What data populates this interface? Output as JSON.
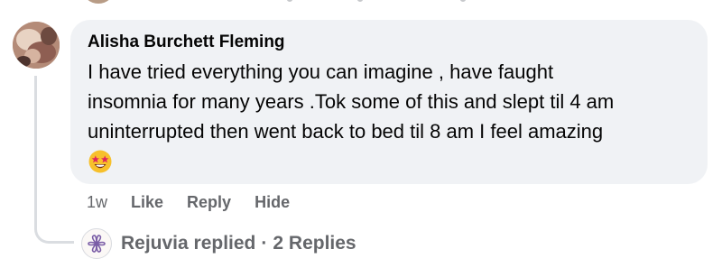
{
  "comment": {
    "author": "Alisha Burchett Fleming",
    "lines": [
      "I have tried everything you can imagine , have faught",
      "insomnia for many years .Tok some of this and slept til 4 am",
      "uninterrupted then went back to bed til 8 am I feel amazing"
    ],
    "emoji_icon": "star-struck-emoji-icon"
  },
  "actions": {
    "time": "1w",
    "like": "Like",
    "reply": "Reply",
    "hide": "Hide"
  },
  "replies": {
    "replier": "Rejuvia replied",
    "separator": "·",
    "count_label": "2 Replies",
    "avatar_icon": "rejuvia-logo-icon"
  },
  "colors": {
    "bubble_bg": "#f0f2f5",
    "text_primary": "#050505",
    "text_secondary": "#65676b",
    "thread_line": "#dadde1",
    "logo_accent": "#7b5ea7"
  }
}
